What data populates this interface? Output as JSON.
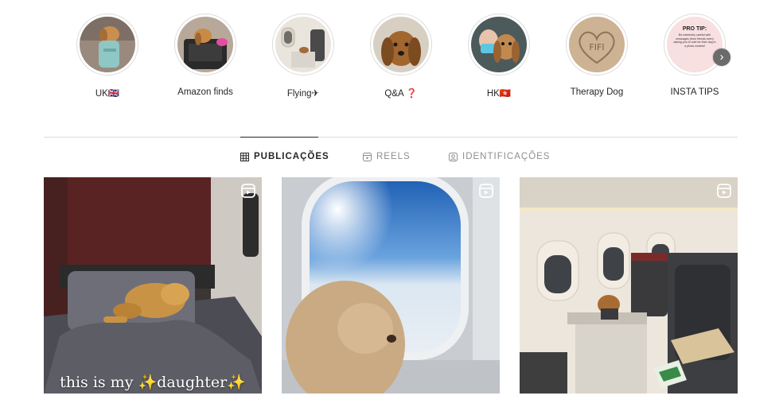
{
  "highlights": [
    {
      "label": "UK🇬🇧",
      "icon": "dog-with-blanket-thumbnail"
    },
    {
      "label": "Amazon finds",
      "icon": "dog-in-carrier-thumbnail"
    },
    {
      "label": "Flying✈",
      "icon": "airplane-cabin-thumbnail"
    },
    {
      "label": "Q&A ❓",
      "icon": "dog-face-thumbnail"
    },
    {
      "label": "HK🇭🇰",
      "icon": "selfie-with-dog-thumbnail"
    },
    {
      "label": "Therapy Dog",
      "icon": "sand-heart-thumbnail"
    },
    {
      "label": "INSTA TIPS",
      "icon": "pro-tip-note-thumbnail"
    }
  ],
  "pro_tip": {
    "title": "PRO TIP:",
    "body": "Be extremely careful with messages (from friends even) asking you to vote for their dog in a photo contest!"
  },
  "sand_text": "FIFI",
  "tabs": [
    {
      "label": "PUBLICAÇÕES",
      "icon": "grid-icon",
      "active": true
    },
    {
      "label": "REELS",
      "icon": "reels-icon",
      "active": false
    },
    {
      "label": "IDENTIFICAÇÕES",
      "icon": "tagged-icon",
      "active": false
    }
  ],
  "posts": [
    {
      "caption_pre": "this is my ",
      "caption_spark1": "✨",
      "caption_mid": "daughter",
      "caption_spark2": "✨",
      "icon": "reel-icon"
    },
    {
      "icon": "reel-icon"
    },
    {
      "icon": "reel-icon"
    }
  ],
  "colors": {
    "divider": "#dbdbdb",
    "text": "#262626",
    "muted": "#8e8e8e"
  }
}
